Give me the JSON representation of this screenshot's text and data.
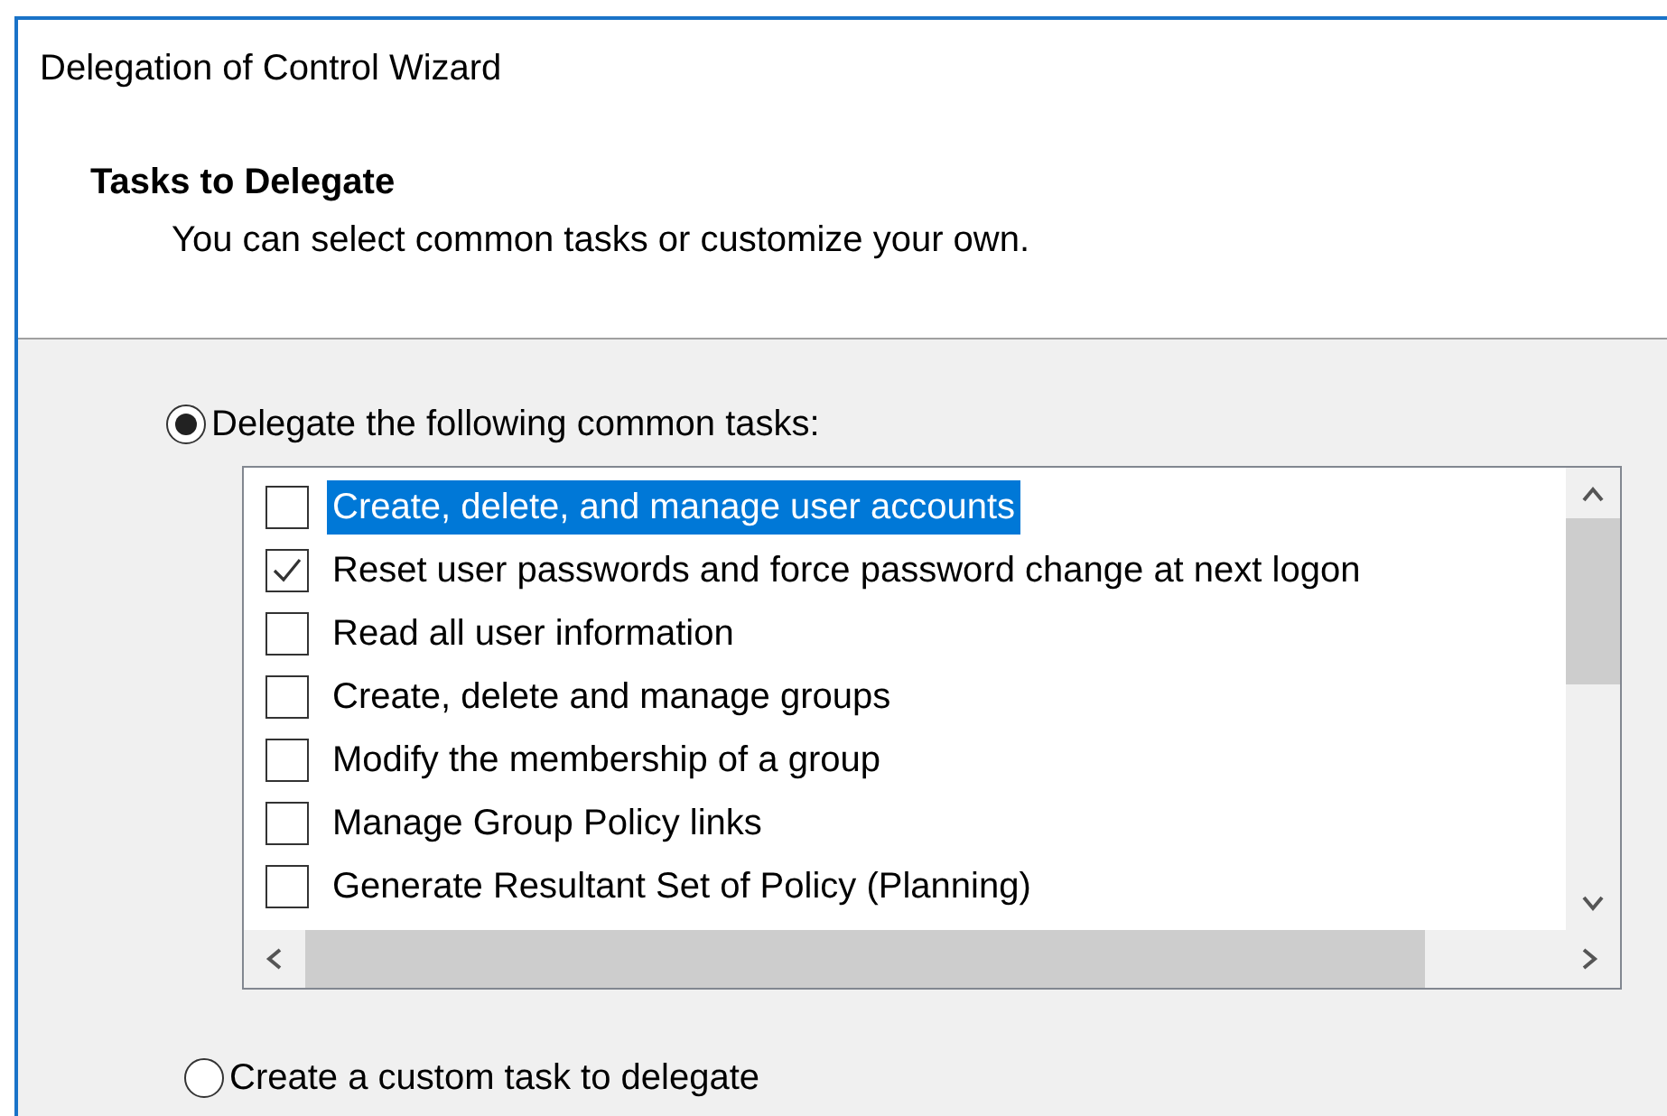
{
  "window": {
    "title": "Delegation of Control Wizard"
  },
  "header": {
    "title": "Tasks to Delegate",
    "subtitle": "You can select common tasks or customize your own."
  },
  "options": [
    {
      "label": "Delegate the following common tasks:",
      "selected": true
    },
    {
      "label": "Create a custom task to delegate",
      "selected": false
    }
  ],
  "tasks": [
    {
      "label": "Create, delete, and manage user accounts",
      "checked": false,
      "selected": true
    },
    {
      "label": "Reset user passwords and force password change at next logon",
      "checked": true,
      "selected": false
    },
    {
      "label": "Read all user information",
      "checked": false,
      "selected": false
    },
    {
      "label": "Create, delete and manage groups",
      "checked": false,
      "selected": false
    },
    {
      "label": "Modify the membership of a group",
      "checked": false,
      "selected": false
    },
    {
      "label": "Manage Group Policy links",
      "checked": false,
      "selected": false
    },
    {
      "label": "Generate Resultant Set of Policy (Planning)",
      "checked": false,
      "selected": false
    }
  ]
}
